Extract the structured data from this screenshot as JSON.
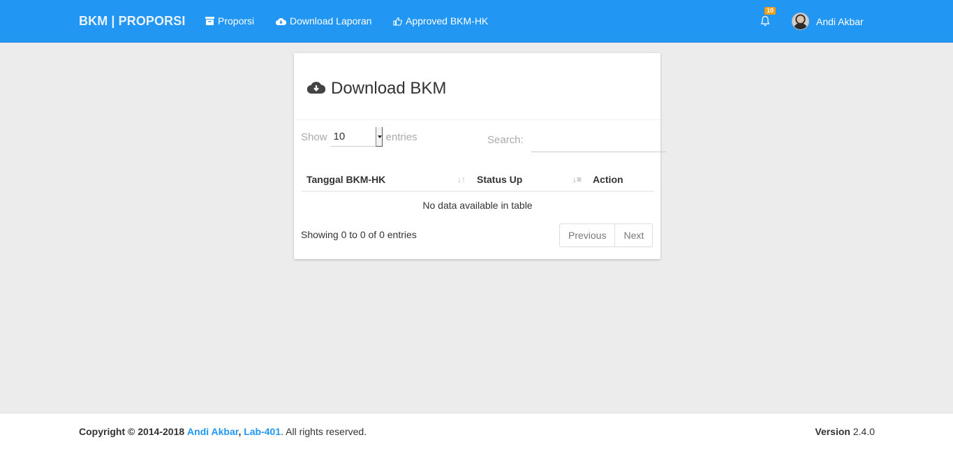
{
  "navbar": {
    "brand": "BKM | PROPORSI",
    "links": [
      {
        "label": "Proporsi",
        "icon": "archive-icon"
      },
      {
        "label": "Download Laporan",
        "icon": "cloud-download-icon"
      },
      {
        "label": "Approved BKM-HK",
        "icon": "thumbs-up-icon"
      }
    ],
    "notifications_count": "10",
    "user_name": "Andi Akbar"
  },
  "card": {
    "title": "Download BKM",
    "show_label": "Show",
    "entries_value": "10",
    "entries_label": "entries",
    "search_label": "Search:",
    "search_value": "",
    "columns": [
      "Tanggal BKM-HK",
      "Status Up",
      "Action"
    ],
    "empty_message": "No data available in table",
    "info": "Showing 0 to 0 of 0 entries",
    "prev_label": "Previous",
    "next_label": "Next"
  },
  "footer": {
    "copyright_prefix": "Copyright © 2014-2018",
    "author": "Andi Akbar",
    "separator": ",",
    "lab": "Lab-401",
    "suffix": ". All rights reserved.",
    "version_label": "Version",
    "version_value": "2.4.0"
  },
  "colors": {
    "navbar": "#2196f3",
    "badge": "#f39c12",
    "background": "#ececec",
    "link": "#2196f3"
  }
}
